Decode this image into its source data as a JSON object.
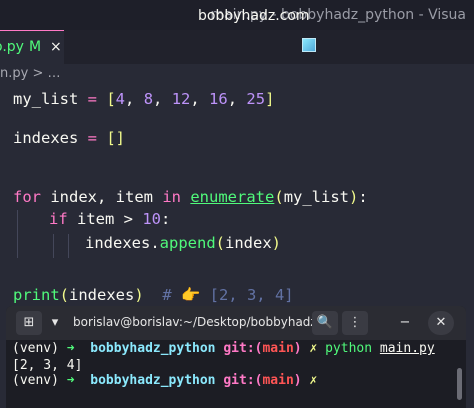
{
  "window": {
    "title": "main.py - bobbyhadz_python - Visua"
  },
  "tab": {
    "name": "o.py",
    "modified": "M",
    "close": "×"
  },
  "watermark": {
    "text": "bobbyhadz.com",
    "icon": "cube-icon"
  },
  "breadcrumb": {
    "text": "n.py > …"
  },
  "code": {
    "l1": {
      "var": "my_list",
      "op": " = ",
      "open": "[",
      "n1": "4",
      "n2": "8",
      "n3": "12",
      "n4": "16",
      "n5": "25",
      "close": "]",
      "sep": ", "
    },
    "l2": {
      "var": "indexes",
      "op": " = ",
      "brackets": "[]"
    },
    "l3": {
      "kw_for": "for",
      "vars": " index, item ",
      "kw_in": "in",
      "fn": "enumerate",
      "open": "(",
      "arg": "my_list",
      "close": ")",
      "colon": ":"
    },
    "l4": {
      "kw_if": "if",
      "cond": " item > ",
      "num": "10",
      "colon": ":"
    },
    "l5": {
      "obj": "indexes.",
      "method": "append",
      "open": "(",
      "arg": "index",
      "close": ")"
    },
    "l6": {
      "fn": "print",
      "open": "(",
      "arg": "indexes",
      "close": ")",
      "comment": "  # 👉️ [2, 3, 4]"
    }
  },
  "terminal": {
    "title": "borislav@borislav:~/Desktop/bobbyhadz_...",
    "buttons": {
      "new_tab": "⊞",
      "dropdown": "▾",
      "search": "🔍",
      "menu": "⋮",
      "minimize": "−",
      "close": "✕"
    },
    "line1": {
      "venv": "(venv) ",
      "arrow": "➜",
      "dir": "  bobbyhadz_python ",
      "git": "git:(",
      "branch": "main",
      "git_close": ")",
      "x": " ✗ ",
      "cmd": "python",
      "sp": " ",
      "file": "main.py"
    },
    "line2": {
      "text": "[2, 3, 4]"
    },
    "line3": {
      "venv": "(venv) ",
      "arrow": "➜",
      "dir": "  bobbyhadz_python ",
      "git": "git:(",
      "branch": "main",
      "git_close": ")",
      "x": " ✗"
    }
  }
}
